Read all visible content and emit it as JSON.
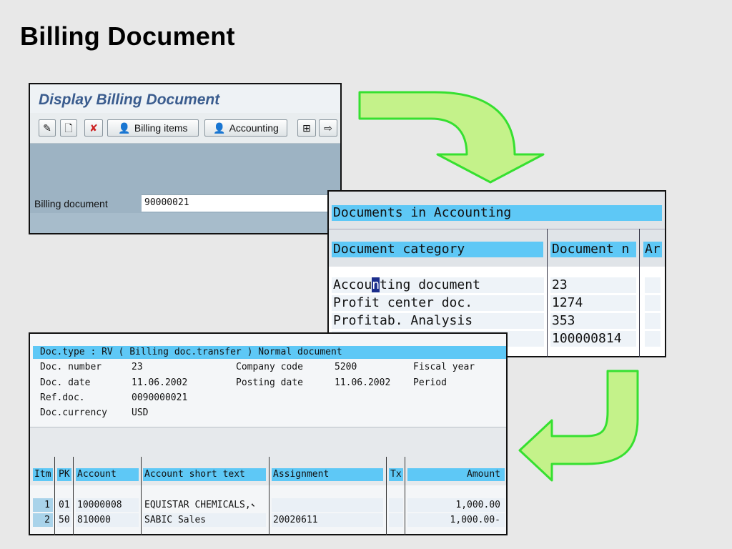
{
  "slide": {
    "title": "Billing Document"
  },
  "display_window": {
    "title": "Display Billing Document",
    "toolbar": {
      "billing_items_label": "Billing items",
      "accounting_label": "Accounting"
    },
    "billing_document_label": "Billing document",
    "billing_document_value": "90000021"
  },
  "accounting_docs": {
    "title": "Documents in Accounting",
    "columns": [
      "Document category",
      "Document n",
      "Ar"
    ],
    "rows": [
      {
        "category_pre": "Accou",
        "category_cursor": "n",
        "category_post": "ting document",
        "number": "23"
      },
      {
        "category": "Profit center doc.",
        "number": "1274"
      },
      {
        "category": "Profitab. Analysis",
        "number": "353"
      },
      {
        "category": "",
        "number": "100000814"
      }
    ]
  },
  "accounting_document": {
    "header_line": "Doc.type : RV ( Billing doc.transfer ) Normal document",
    "fields": {
      "doc_number_label": "Doc. number",
      "doc_number": "23",
      "company_code_label": "Company code",
      "company_code": "5200",
      "fiscal_year_label": "Fiscal year",
      "doc_date_label": "Doc. date",
      "doc_date": "11.06.2002",
      "posting_date_label": "Posting date",
      "posting_date": "11.06.2002",
      "period_label": "Period",
      "ref_doc_label": "Ref.doc.",
      "ref_doc": "0090000021",
      "currency_label": "Doc.currency",
      "currency": "USD"
    },
    "columns": {
      "itm": "Itm",
      "pk": "PK",
      "account": "Account",
      "short_text": "Account short text",
      "assignment": "Assignment",
      "tx": "Tx",
      "amount": "Amount"
    },
    "items": [
      {
        "itm": "1",
        "pk": "01",
        "account": "10000008",
        "short_text": "EQUISTAR CHEMICALS,",
        "assignment": "",
        "tx": "",
        "amount": "1,000.00"
      },
      {
        "itm": "2",
        "pk": "50",
        "account": "810000",
        "short_text": "SABIC Sales",
        "assignment": "20020611",
        "tx": "",
        "amount": "1,000.00-"
      }
    ]
  },
  "colors": {
    "highlight_blue": "#5ec8f6",
    "arrow_green": "#c4f28a",
    "arrow_outline": "#36e030",
    "title_blue": "#3a5c8e"
  },
  "icons": [
    "pencil-icon",
    "new-document-icon",
    "delete-icon",
    "billing-items-person-icon",
    "accounting-person-icon",
    "document-flow-icon",
    "export-icon"
  ]
}
